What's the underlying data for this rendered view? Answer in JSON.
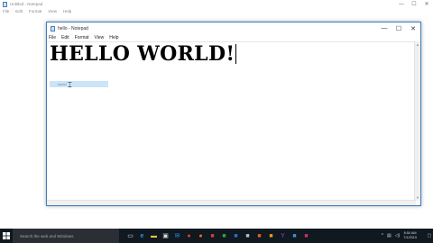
{
  "background_app": {
    "title": "Untitled - Notepad",
    "menu": [
      "File",
      "Edit",
      "Format",
      "View",
      "Help"
    ],
    "controls": [
      "—",
      "☐",
      "✕"
    ]
  },
  "window": {
    "title": "hello - Notepad",
    "menu": [
      "File",
      "Edit",
      "Format",
      "View",
      "Help"
    ],
    "controls": [
      "—",
      "☐",
      "✕"
    ],
    "editor_line1": "HELLO WORLD!",
    "selected_text": "world"
  },
  "taskbar": {
    "search_placeholder": "Search the web and Windows",
    "start_icon": "windows-logo-icon",
    "icons": [
      "task-view-icon",
      "edge-icon",
      "file-explorer-icon",
      "store-icon",
      "mail-icon",
      "chrome-icon",
      "firefox-icon",
      "app-icon-1",
      "app-icon-2",
      "app-icon-3",
      "app-icon-4",
      "app-icon-5",
      "app-icon-6",
      "yahoo-icon",
      "app-icon-7",
      "app-icon-8"
    ],
    "time": "8:50 AM",
    "date": "7/1/2019",
    "accent": "#101820"
  }
}
